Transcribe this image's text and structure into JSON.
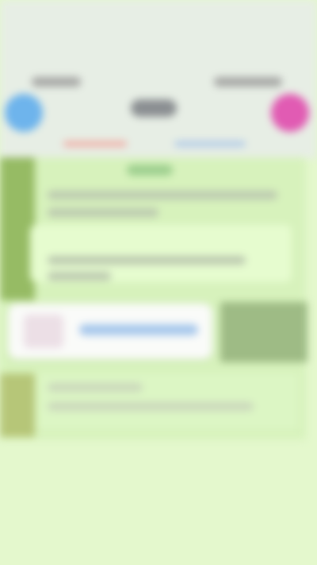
{
  "chat": {
    "top_left_avatar": "avatar-left",
    "top_right_avatar": "avatar-right",
    "accent_red": "#f1a39c",
    "accent_blue": "#a7c4e8",
    "avatar_left_color": "#6eb4ec",
    "avatar_right_color": "#e15bb3"
  }
}
